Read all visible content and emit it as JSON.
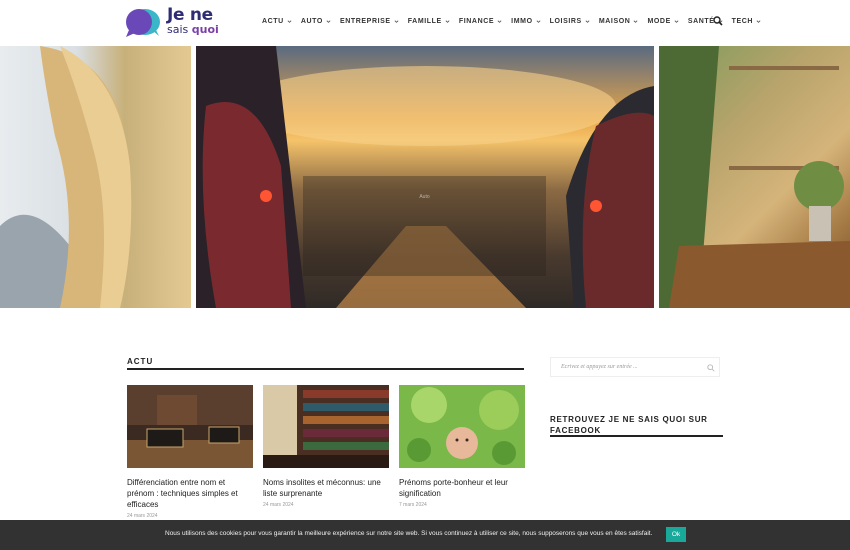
{
  "brand": {
    "line1": "Je ne",
    "line2_a": "sais ",
    "line2_b": "quoi",
    "colors": {
      "primary": "#2e2c72",
      "accent": "#7a3fa8",
      "teal": "#19a99a"
    }
  },
  "nav": {
    "items": [
      {
        "label": "ACTU"
      },
      {
        "label": "AUTO"
      },
      {
        "label": "ENTREPRISE"
      },
      {
        "label": "FAMILLE"
      },
      {
        "label": "FINANCE"
      },
      {
        "label": "IMMO"
      },
      {
        "label": "LOISIRS"
      },
      {
        "label": "MAISON"
      },
      {
        "label": "MODE"
      },
      {
        "label": "SANTÉ"
      },
      {
        "label": "TECH"
      }
    ],
    "search_icon": "search-icon"
  },
  "hero": {
    "overlay_label": "Auto"
  },
  "section": {
    "title": "ACTU",
    "cards": [
      {
        "title": "Différenciation entre nom et prénom : techniques simples et efficaces",
        "date": "24 mars 2024"
      },
      {
        "title": "Noms insolites et méconnus: une liste surprenante",
        "date": "24 mars 2024"
      },
      {
        "title": "Prénoms porte-bonheur et leur signification",
        "date": "7 mars 2024"
      }
    ]
  },
  "sidebar": {
    "search_placeholder": "Ecrivez et appuyez sur entrée ...",
    "facebook_title": "RETROUVEZ JE NE SAIS QUOI SUR FACEBOOK"
  },
  "cookie": {
    "text": "Nous utilisons des cookies pour vous garantir la meilleure expérience sur notre site web. Si vous continuez à utiliser ce site, nous supposerons que vous en êtes satisfait.",
    "ok_label": "Ok"
  }
}
